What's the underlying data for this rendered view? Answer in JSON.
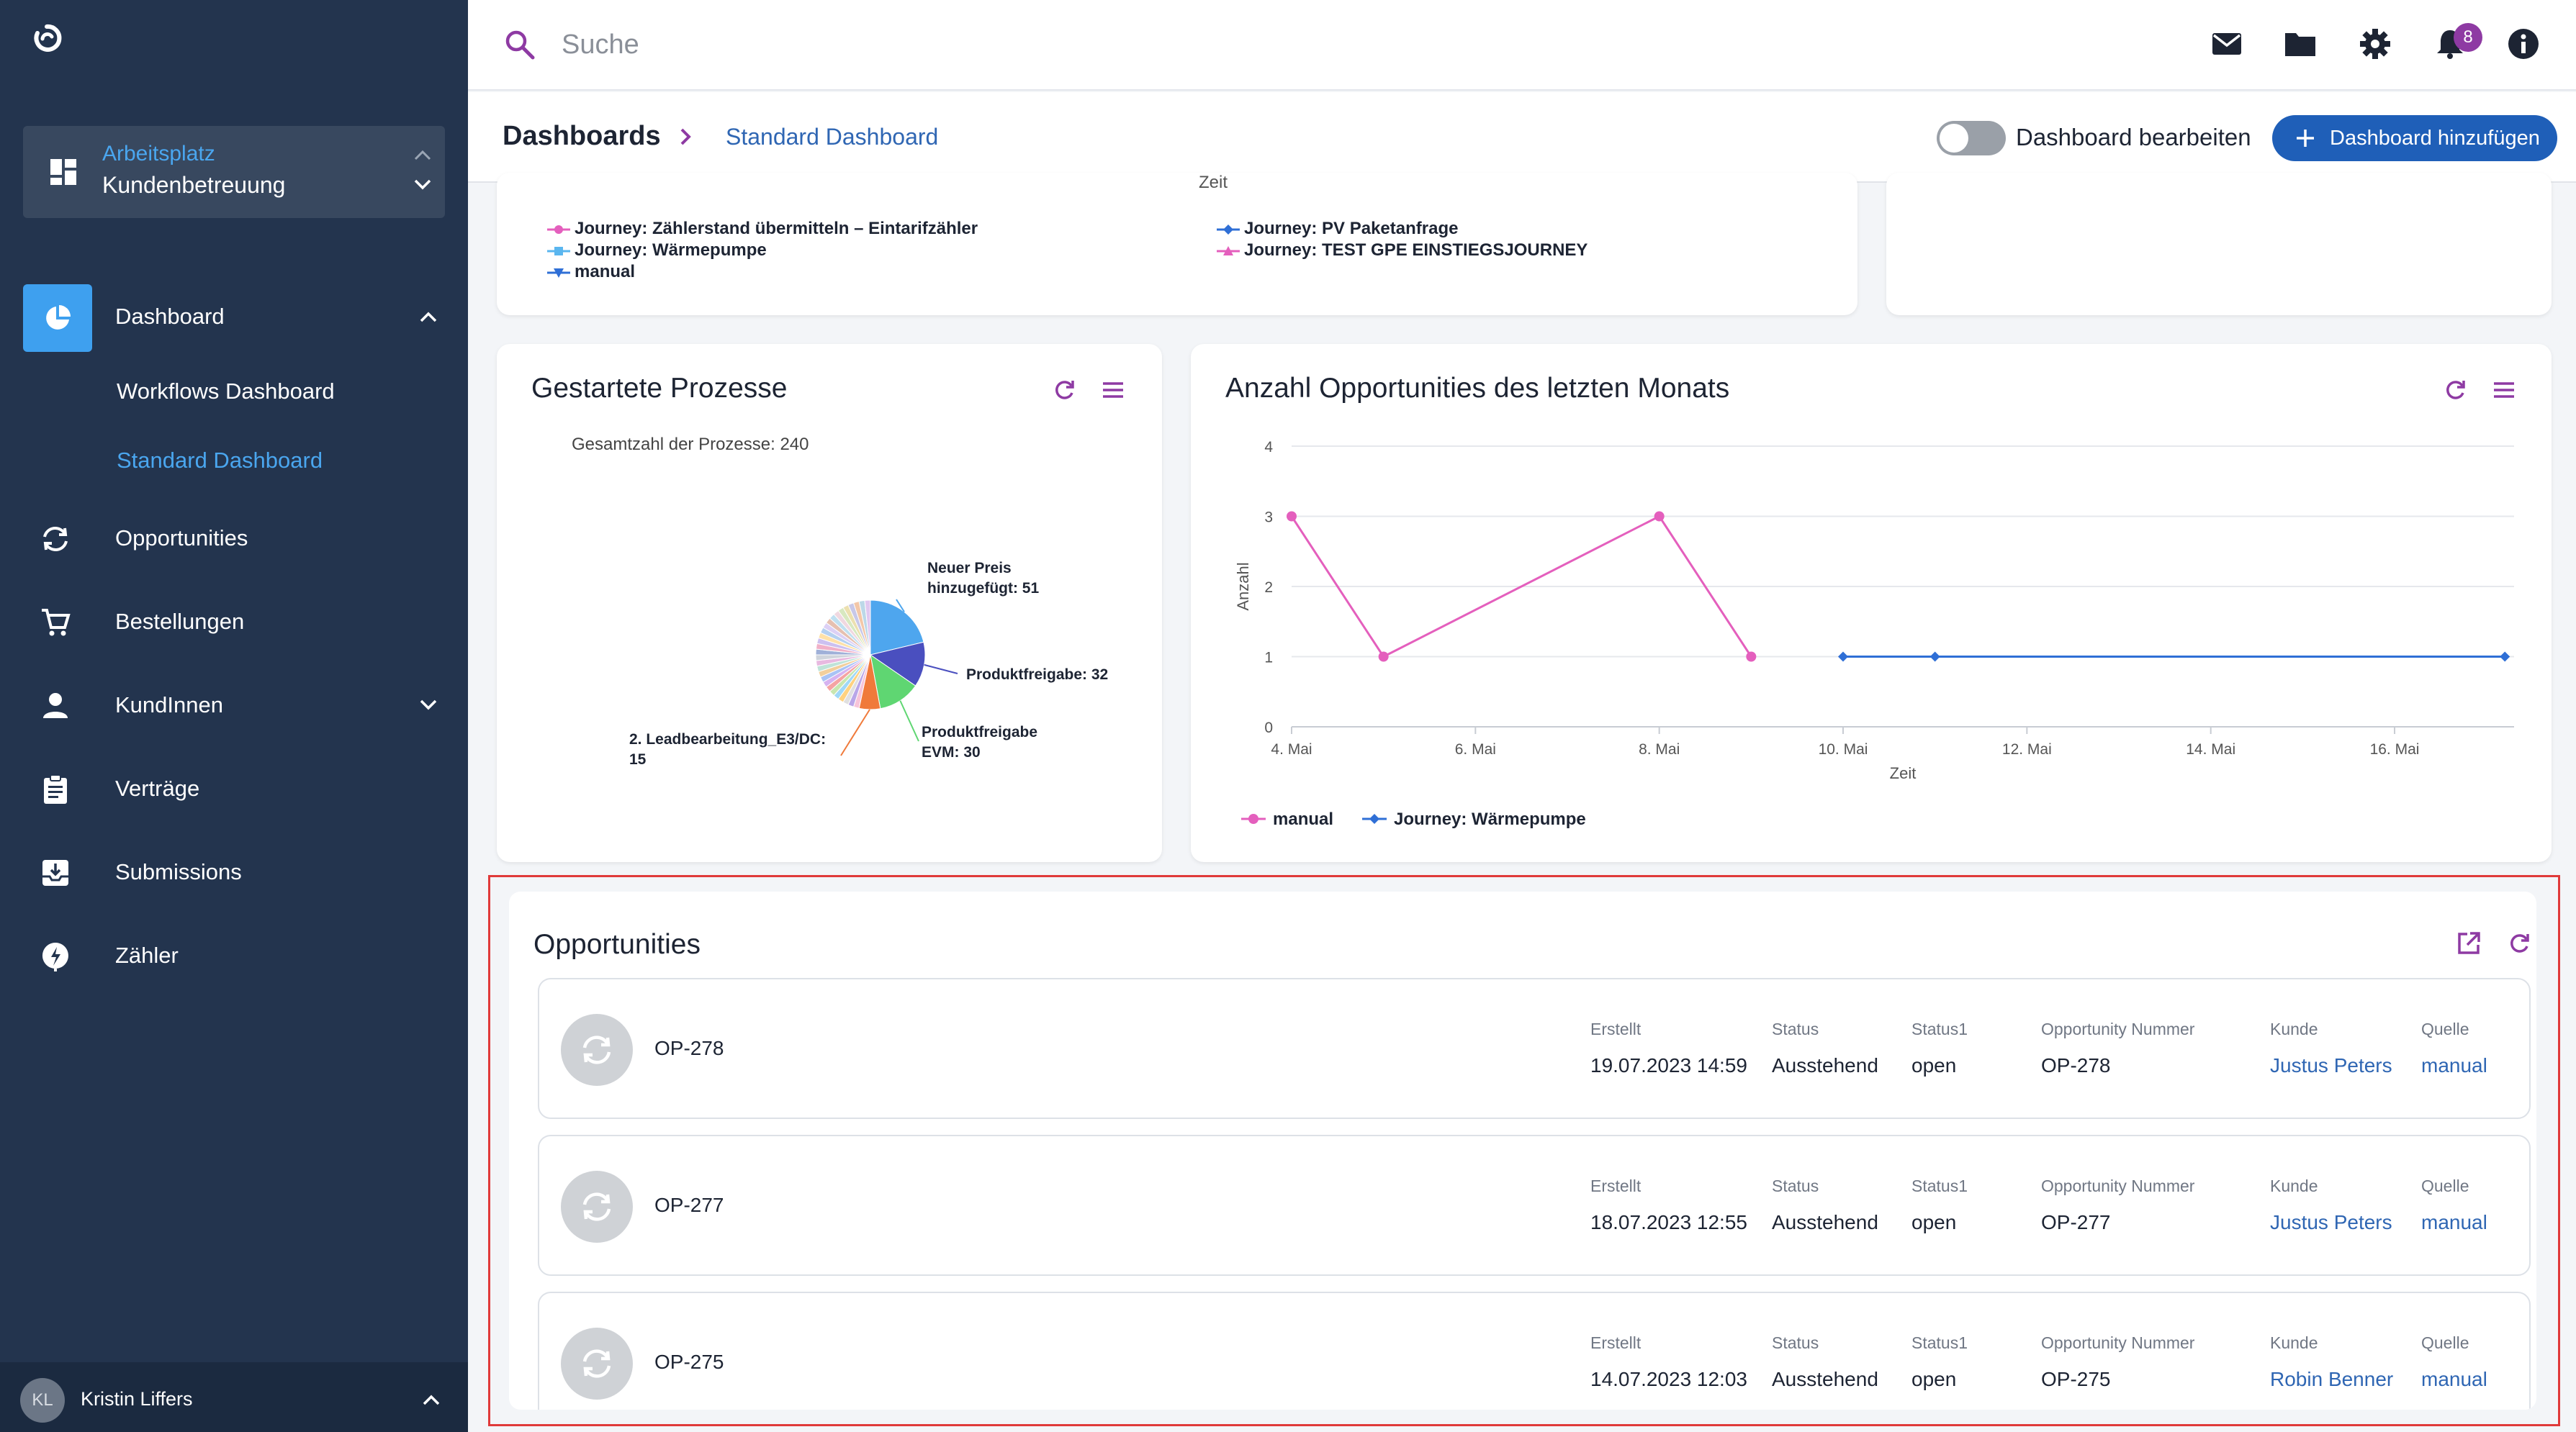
{
  "sidebar": {
    "workspace_label": "Arbeitsplatz",
    "workspace_value": "Kundenbetreuung",
    "items": [
      {
        "label": "Dashboard",
        "icon": "pie-chart-icon"
      },
      {
        "label": "Opportunities",
        "icon": "sync-icon"
      },
      {
        "label": "Bestellungen",
        "icon": "cart-icon"
      },
      {
        "label": "KundInnen",
        "icon": "person-icon"
      },
      {
        "label": "Verträge",
        "icon": "clipboard-icon"
      },
      {
        "label": "Submissions",
        "icon": "inbox-icon"
      },
      {
        "label": "Zähler",
        "icon": "meter-icon"
      }
    ],
    "dashboard_sub": [
      "Workflows Dashboard",
      "Standard Dashboard"
    ],
    "user": {
      "initials": "KL",
      "name": "Kristin Liffers"
    }
  },
  "header": {
    "search_placeholder": "Suche",
    "notification_count": "8"
  },
  "subheader": {
    "title": "Dashboards",
    "breadcrumb": "Standard Dashboard",
    "toggle_label": "Dashboard bearbeiten",
    "add_button": "Dashboard hinzufügen"
  },
  "top_card": {
    "axis_fragment": "Zeit",
    "legend": [
      {
        "label": "Journey: Zählerstand übermitteln – Eintarifzähler",
        "color": "#e45fbd",
        "marker": "circle"
      },
      {
        "label": "Journey: PV Paketanfrage",
        "color": "#2f6fd6",
        "marker": "diamond"
      },
      {
        "label": "Journey: Wärmepumpe",
        "color": "#5ab6ef",
        "marker": "square"
      },
      {
        "label": "Journey: TEST GPE EINSTIEGSJOURNEY",
        "color": "#e45fbd",
        "marker": "triangle"
      },
      {
        "label": "manual",
        "color": "#2f6fd6",
        "marker": "triangle-down"
      }
    ]
  },
  "pie_card": {
    "title": "Gestartete Prozesse",
    "subtitle": "Gesamtzahl der Prozesse: 240",
    "chart_data": {
      "type": "pie",
      "title": "Gesamtzahl der Prozesse: 240",
      "total": 240,
      "slices": [
        {
          "label": "Neuer Preis hinzugefügt",
          "value": 51,
          "color": "#4ea6ee",
          "labelled": true
        },
        {
          "label": "Produktfreigabe",
          "value": 32,
          "color": "#4a4fbf",
          "labelled": true
        },
        {
          "label": "Produktfreigabe EVM",
          "value": 30,
          "color": "#5fd672",
          "labelled": true
        },
        {
          "label": "2. Leadbearbeitung_E3/DC",
          "value": 15,
          "color": "#f07a3a",
          "labelled": true
        }
      ],
      "labels_printed": [
        "Neuer Preis hinzugefügt: 51",
        "Produktfreigabe: 32",
        "Produktfreigabe EVM: 30",
        "2. Leadbearbeitung_E3/DC: 15"
      ]
    }
  },
  "line_card": {
    "title": "Anzahl Opportunities des letzten Monats",
    "chart_data": {
      "type": "line",
      "xlabel": "Zeit",
      "ylabel": "Anzahl",
      "ylim": [
        0,
        4
      ],
      "yticks": [
        "0",
        "1",
        "2",
        "3",
        "4"
      ],
      "xlim": [
        4,
        17.3
      ],
      "xticks": [
        {
          "v": 4,
          "label": "4. Mai"
        },
        {
          "v": 6,
          "label": "6. Mai"
        },
        {
          "v": 8,
          "label": "8. Mai"
        },
        {
          "v": 10,
          "label": "10. Mai"
        },
        {
          "v": 12,
          "label": "12. Mai"
        },
        {
          "v": 14,
          "label": "14. Mai"
        },
        {
          "v": 16,
          "label": "16. Mai"
        }
      ],
      "series": [
        {
          "name": "manual",
          "color": "#e45fbd",
          "marker": "circle",
          "points": [
            [
              4,
              3
            ],
            [
              5,
              1
            ],
            [
              8,
              3
            ],
            [
              9,
              1
            ]
          ]
        },
        {
          "name": "Journey: Wärmepumpe",
          "color": "#2f6fd6",
          "marker": "diamond",
          "points": [
            [
              10,
              1
            ],
            [
              11,
              1
            ],
            [
              17.2,
              1
            ]
          ]
        }
      ],
      "legend_position": "bottom-left",
      "grid": true
    }
  },
  "opportunities": {
    "title": "Opportunities",
    "labels": {
      "created": "Erstellt",
      "status": "Status",
      "status1": "Status1",
      "number": "Opportunity Nummer",
      "customer": "Kunde",
      "source": "Quelle"
    },
    "rows": [
      {
        "id": "OP-278",
        "created": "19.07.2023 14:59",
        "status": "Ausstehend",
        "status1": "open",
        "number": "OP-278",
        "customer": "Justus Peters",
        "source": "manual"
      },
      {
        "id": "OP-277",
        "created": "18.07.2023 12:55",
        "status": "Ausstehend",
        "status1": "open",
        "number": "OP-277",
        "customer": "Justus Peters",
        "source": "manual"
      },
      {
        "id": "OP-275",
        "created": "14.07.2023 12:03",
        "status": "Ausstehend",
        "status1": "open",
        "number": "OP-275",
        "customer": "Robin Benner",
        "source": "manual"
      }
    ]
  },
  "colors": {
    "sidebar": "#23344e",
    "accent": "#3ea0ef",
    "primary_button": "#1f5fb8",
    "icon_purple": "#8e3aa3",
    "highlight": "#e03a3a"
  }
}
